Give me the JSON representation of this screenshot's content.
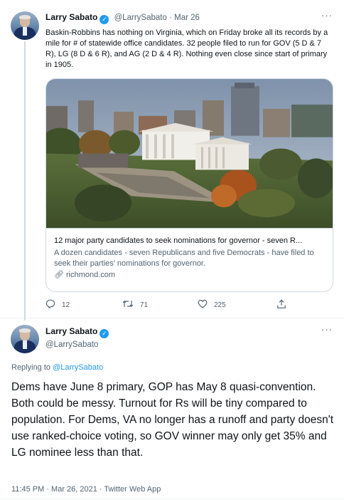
{
  "tweet1": {
    "author_name": "Larry Sabato",
    "handle": "@LarrySabato",
    "separator": "·",
    "date": "Mar 26",
    "more_label": "···",
    "text": "Baskin-Robbins has nothing on Virginia, which on Friday broke all its records by a mile for # of statewide office candidates. 32 people filed to run for GOV (5 D & 7 R), LG (8 D & 6 R), and AG (2 D & 4 R). Nothing even close since start of primary in 1905.",
    "card": {
      "title": "12 major party candidates to seek nominations for governor - seven R...",
      "description": "A dozen candidates - seven Republicans and five Democrats - have filed to seek their parties' nominations for governor.",
      "domain": "richmond.com",
      "icons": {
        "image": "capitol-photo",
        "link": "link-icon"
      }
    },
    "actions": {
      "reply_count": "12",
      "retweet_count": "71",
      "like_count": "225",
      "icons": {
        "reply": "reply-icon",
        "retweet": "retweet-icon",
        "like": "heart-icon",
        "share": "share-icon"
      }
    }
  },
  "tweet2": {
    "author_name": "Larry Sabato",
    "handle": "@LarrySabato",
    "more_label": "···",
    "replying_prefix": "Replying to ",
    "replying_to": "@LarrySabato",
    "text": "Dems have June 8 primary, GOP has May 8 quasi-convention. Both could be messy. Turnout for Rs will be tiny compared to population. For Dems, VA no longer has a runoff and party doesn't use ranked-choice voting, so GOV winner may only get 35% and LG nominee less than that.",
    "timestamp": "11:45 PM · Mar 26, 2021 · Twitter Web App"
  },
  "colors": {
    "accent": "#1d9bf0",
    "text": "#0f1419",
    "muted": "#536471",
    "border": "#cfd9de"
  }
}
